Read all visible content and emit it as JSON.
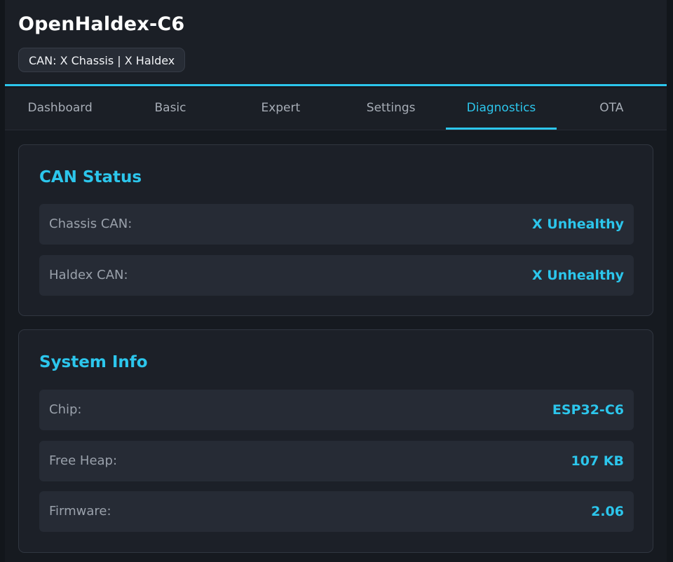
{
  "app": {
    "title": "OpenHaldex-C6",
    "can_badge": "CAN: X Chassis | X Haldex"
  },
  "tabs": [
    {
      "label": "Dashboard",
      "active": false
    },
    {
      "label": "Basic",
      "active": false
    },
    {
      "label": "Expert",
      "active": false
    },
    {
      "label": "Settings",
      "active": false
    },
    {
      "label": "Diagnostics",
      "active": true
    },
    {
      "label": "OTA",
      "active": false
    }
  ],
  "can_status": {
    "title": "CAN Status",
    "rows": [
      {
        "label": "Chassis CAN:",
        "value": "X Unhealthy"
      },
      {
        "label": "Haldex CAN:",
        "value": "X Unhealthy"
      }
    ]
  },
  "system_info": {
    "title": "System Info",
    "rows": [
      {
        "label": "Chip:",
        "value": "ESP32-C6"
      },
      {
        "label": "Free Heap:",
        "value": "107 KB"
      },
      {
        "label": "Firmware:",
        "value": "2.06"
      }
    ]
  },
  "colors": {
    "accent": "#2cc6ec",
    "background": "#12161b",
    "card": "#1c2028",
    "row": "#262b35"
  }
}
